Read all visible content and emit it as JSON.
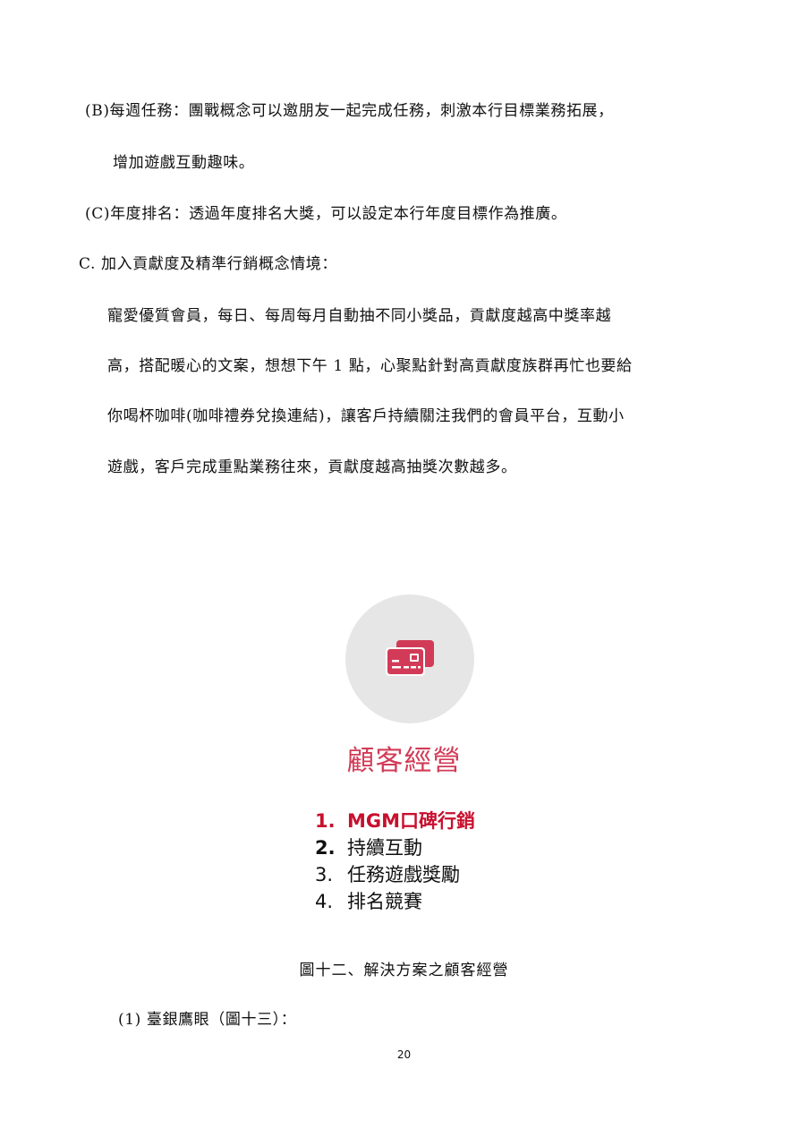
{
  "body": {
    "lines": [
      "(B)每週任務：團戰概念可以邀朋友一起完成任務，刺激本行目標業務拓展，",
      "增加遊戲互動趣味。",
      "(C)年度排名：透過年度排名大獎，可以設定本行年度目標作為推廣。",
      "C.  加入貢獻度及精準行銷概念情境：",
      "寵愛優質會員，每日、每周每月自動抽不同小獎品，貢獻度越高中獎率越",
      "高，搭配暖心的文案，想想下午 1 點，心聚點針對高貢獻度族群再忙也要給",
      "你喝杯咖啡(咖啡禮券兌換連結)，讓客戶持續關注我們的會員平台，互動小",
      "遊戲，客戶完成重點業務往來，貢獻度越高抽獎次數越多。"
    ]
  },
  "figure": {
    "icon": "credit-card-icon",
    "title": "顧客經營",
    "items": [
      {
        "number": "1.",
        "label": "MGM口碑行銷"
      },
      {
        "number": "2.",
        "label": "持續互動"
      },
      {
        "number": "3.",
        "label": "任務遊戲獎勵"
      },
      {
        "number": "4.",
        "label": "排名競賽"
      }
    ],
    "colors": {
      "title": "#d23b57",
      "highlight": "#c8102e",
      "circle": "#e6e6e6",
      "icon": "#d23b57"
    }
  },
  "caption": "圖十二、解決方案之顧客經營",
  "subsection": "(1)  臺銀鷹眼（圖十三）：",
  "page_number": "20"
}
